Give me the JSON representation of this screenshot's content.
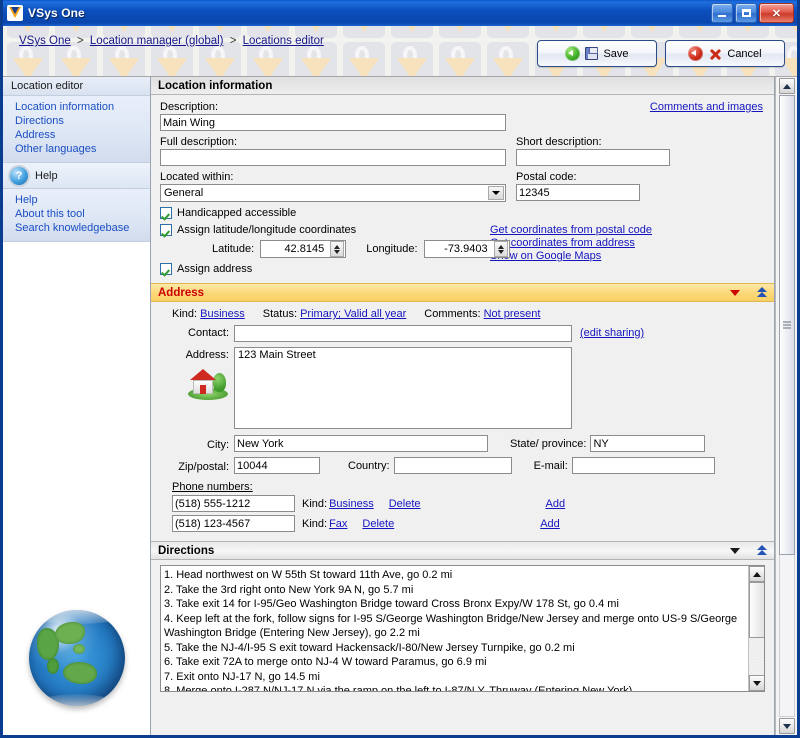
{
  "window": {
    "title": "VSys One",
    "minimize_label": "Minimize",
    "maximize_label": "Maximize",
    "close_label": "Close"
  },
  "breadcrumb": {
    "items": [
      "VSys One",
      "Location manager (global)",
      "Locations editor"
    ],
    "separator": ">"
  },
  "toolbar": {
    "save_label": "Save",
    "cancel_label": "Cancel"
  },
  "sidebar": {
    "panel_title": "Location editor",
    "items": [
      {
        "label": "Location information"
      },
      {
        "label": "Directions"
      },
      {
        "label": "Address"
      },
      {
        "label": "Other languages"
      }
    ],
    "help_title": "Help",
    "help_icon": "question-circle-icon",
    "help_items": [
      {
        "label": "Help"
      },
      {
        "label": "About this tool"
      },
      {
        "label": "Search knowledgebase"
      }
    ],
    "globe_icon": "globe-icon"
  },
  "location_information": {
    "section_title": "Location information",
    "comments_link": "Comments and images",
    "description_label": "Description:",
    "description_value": "Main Wing",
    "full_description_label": "Full description:",
    "full_description_value": "",
    "short_description_label": "Short description:",
    "short_description_value": "",
    "located_within_label": "Located within:",
    "located_within_value": "General",
    "located_within_options": [
      "General"
    ],
    "postal_code_label": "Postal code:",
    "postal_code_value": "12345",
    "handicapped_label": "Handicapped accessible",
    "handicapped_checked": true,
    "assign_latlong_label": "Assign latitude/longitude coordinates",
    "assign_latlong_checked": true,
    "latitude_label": "Latitude:",
    "latitude_value": "42.8145",
    "longitude_label": "Longitude:",
    "longitude_value": "-73.9403",
    "coord_links": [
      {
        "label": "Get coordinates from postal code"
      },
      {
        "label": "Get coordinates from address"
      },
      {
        "label": "Show on Google Maps"
      }
    ],
    "assign_address_label": "Assign address",
    "assign_address_checked": true
  },
  "address": {
    "section_title": "Address",
    "collapse_icon": "triangle-down-icon",
    "expand_icon": "double-chevron-up-icon",
    "kind_label": "Kind:",
    "kind_value": "Business",
    "status_label": "Status:",
    "status_value": "Primary; Valid all year",
    "comments_label": "Comments:",
    "comments_value": "Not present",
    "contact_label": "Contact:",
    "contact_value": "",
    "edit_sharing_link": "(edit sharing)",
    "address_label": "Address:",
    "address_value": "123 Main Street",
    "house_icon": "house-icon",
    "city_label": "City:",
    "city_value": "New York",
    "state_label": "State/ province:",
    "state_value": "NY",
    "zip_label": "Zip/postal:",
    "zip_value": "10044",
    "country_label": "Country:",
    "country_value": "",
    "email_label": "E-mail:",
    "email_value": "",
    "phone_header": "Phone numbers:",
    "phones": [
      {
        "number": "(518) 555-1212",
        "kind_label": "Kind:",
        "kind_value": "Business",
        "delete_label": "Delete",
        "add_label": "Add"
      },
      {
        "number": "(518) 123-4567",
        "kind_label": "Kind:",
        "kind_value": "Fax",
        "delete_label": "Delete",
        "add_label": "Add"
      }
    ]
  },
  "directions": {
    "section_title": "Directions",
    "collapse_icon": "triangle-down-icon",
    "expand_icon": "double-chevron-up-icon",
    "steps": [
      "1. Head northwest on W 55th St toward 11th Ave, go 0.2 mi",
      "2. Take the 3rd right onto New York 9A N, go 5.7 mi",
      "3. Take exit 14 for I-95/Geo Washington Bridge toward Cross Bronx Expy/W 178 St, go 0.4 mi",
      "4. Keep left at the fork, follow signs for I-95 S/George Washington Bridge/New Jersey and merge onto US-9 S/George Washington Bridge (Entering New Jersey), go 2.2 mi",
      "5. Take the NJ-4/I-95 S exit toward Hackensack/I-80/New Jersey Turnpike, go 0.2 mi",
      "6. Take exit 72A to merge onto NJ-4 W toward Paramus, go 6.9 mi",
      "7. Exit onto NJ-17 N, go 14.5 mi",
      "8. Merge onto I-287 N/NJ-17 N via the ramp on the left to I-87/N Y. Thruway (Entering New York)"
    ]
  },
  "colors": {
    "title_bar": "#0c4fbd",
    "link": "#1515c0",
    "address_header_bg": "#fcd97a",
    "address_header_text": "#cc0000"
  }
}
